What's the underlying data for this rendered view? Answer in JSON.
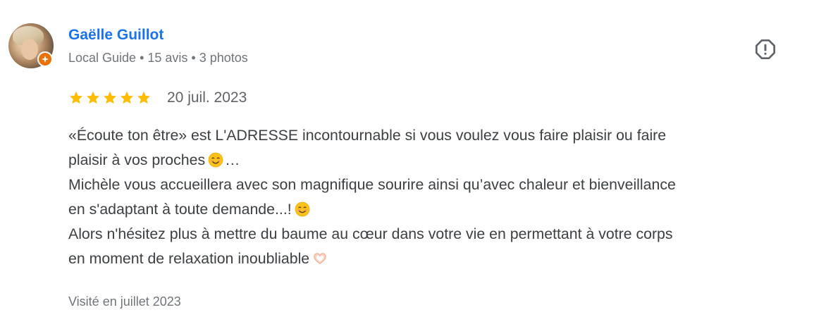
{
  "reviewer": {
    "name": "Gaëlle Guillot",
    "meta": "Local Guide • 15 avis • 3 photos",
    "avatar_icon": "user-photo-avatar",
    "badge_icon": "local-guide-star-icon",
    "badge_color": "#e8710a"
  },
  "report": {
    "icon": "report-flag-icon"
  },
  "rating": {
    "stars": 5,
    "max_stars": 5,
    "star_color": "#fbbc04",
    "date": "20 juil. 2023"
  },
  "review": {
    "line1": "«Écoute ton être» est L'ADRESSE incontournable si vous voulez vous faire plaisir ou faire",
    "line2": "plaisir à vos proches",
    "line2_suffix": "…",
    "line3": "Michèle vous accueillera avec son magnifique sourire ainsi qu’avec chaleur et bienveillance",
    "line4": "en s'adaptant à toute demande...!",
    "line5": "Alors n'hésitez plus à mettre du baume au cœur dans votre vie en permettant à votre corps",
    "line6": "en moment de relaxation inoubliable",
    "emoji1": "smiling-face-emoji",
    "emoji2": "smiling-face-emoji",
    "emoji3": "heart-hands-emoji"
  },
  "visit": {
    "text": "Visité en juillet 2023"
  },
  "colors": {
    "name_link": "#1a73e8",
    "secondary_text": "#70757a",
    "body_text": "#3c4043"
  }
}
